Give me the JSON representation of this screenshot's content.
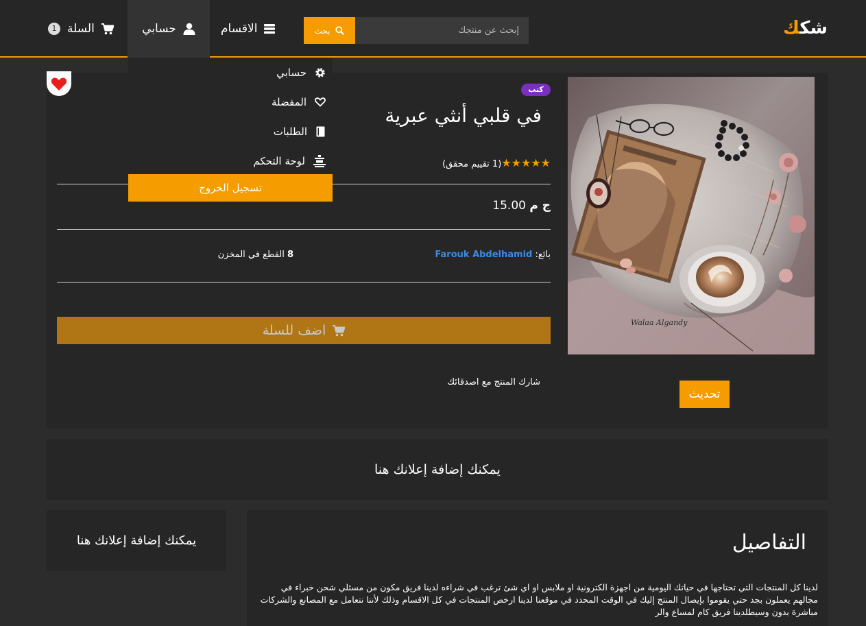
{
  "header": {
    "logo_main": "شك",
    "logo_accent": "ك",
    "search_placeholder": "إبحث عن منتجك",
    "search_button": "بحث",
    "categories_label": "الاقسام",
    "account_label": "حسابي",
    "cart_label": "السلة",
    "cart_count": "1"
  },
  "dropdown": {
    "items": [
      {
        "label": "حسابي",
        "icon": "gear-icon"
      },
      {
        "label": "المفضلة",
        "icon": "heart-outline-icon"
      },
      {
        "label": "الطلبات",
        "icon": "book-icon"
      },
      {
        "label": "لوحة التحكم",
        "icon": "dashboard-icon"
      }
    ],
    "logout": "تسجيل الخروج"
  },
  "product": {
    "tag": "كتب",
    "title": "في قلبي أنثي عبرية",
    "stars": "★★★★★",
    "rating_text": "(1 تقييم محقق)",
    "price_value": "15.00",
    "price_currency": "ج م",
    "seller_label": "بائع:",
    "seller_name": "Farouk Abdelhamid",
    "stock_count": "8",
    "stock_text": "القطع في المخزن",
    "add_to_cart": "اضف للسلة",
    "share_text": "شارك المنتج مع اصدقائك",
    "update_button": "تحديث",
    "image_signature": "Walaa Algandy"
  },
  "ads": {
    "wide": "يمكنك إضافة إعلانك هنا",
    "side": "يمكنك إضافة إعلانك هنا"
  },
  "details": {
    "heading": "التفاصيل",
    "body": "لدينا كل المنتجات التي تحتاجها في حياتك اليومية من اجهزة الكترونية او ملابس او اي شئ ترغب في شراءه لدينا فريق مكون من مسئلي شحن خبراء في مجالهم يعملون بجد حتي يقوموا بإيصال المنتج إليك في الوقت المحدد في موقعنا لدينا ارخص المنتجات في كل الاقسام وذلك لأننا نتعامل مع المصانع والشركات مباشرة بدون وسيطلدينا فريق كام لمساع والر"
  },
  "colors": {
    "accent": "#f59c00",
    "panel": "#262626",
    "background": "#2c2c2c",
    "tag": "#7b2fbf",
    "seller_link": "#3b8be0",
    "add_cart_bg": "#b07615"
  }
}
